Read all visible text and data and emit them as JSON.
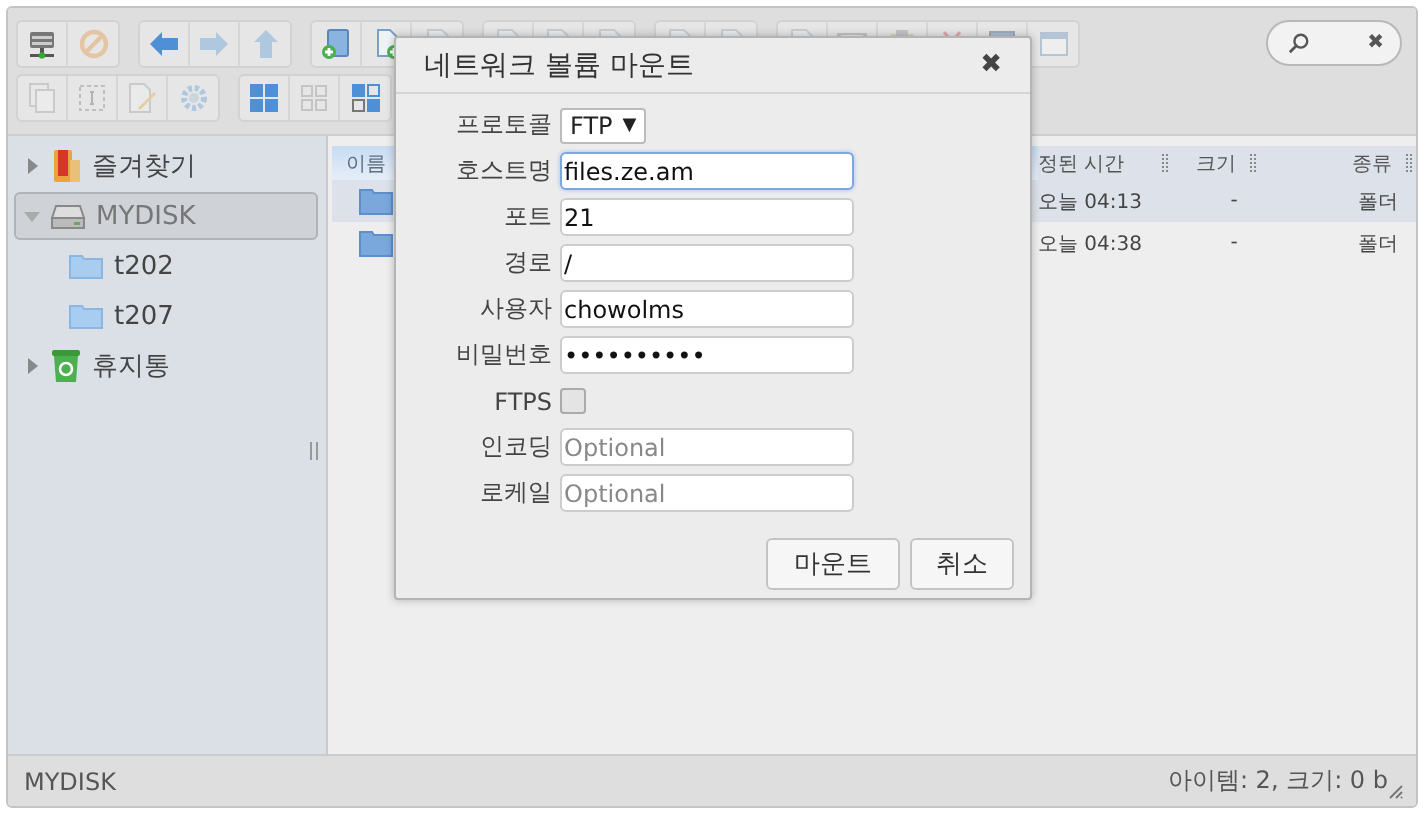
{
  "toolbar": {
    "rows": [
      {
        "groups": [
          {
            "buttons": [
              {
                "disabled": false
              },
              {
                "disabled": true
              }
            ]
          },
          {
            "buttons": [
              {
                "disabled": false
              },
              {
                "disabled": true
              },
              {
                "disabled": true
              }
            ]
          },
          {
            "buttons": [
              {
                "disabled": false
              },
              {
                "disabled": false
              },
              {
                "disabled": true
              }
            ]
          },
          {
            "buttons": [
              {
                "disabled": true
              },
              {
                "disabled": true
              },
              {
                "disabled": true
              }
            ]
          },
          {
            "buttons": [
              {
                "disabled": true
              },
              {
                "disabled": true
              }
            ]
          },
          {
            "buttons": [
              {
                "disabled": true
              },
              {
                "disabled": true
              },
              {
                "disabled": true
              },
              {
                "disabled": true
              },
              {
                "disabled": true
              },
              {
                "disabled": true
              }
            ]
          }
        ]
      },
      {
        "groups": [
          {
            "buttons": [
              {
                "disabled": true
              },
              {
                "disabled": true
              },
              {
                "disabled": true
              },
              {
                "disabled": true
              }
            ]
          },
          {
            "buttons": [
              {
                "disabled": false
              },
              {
                "disabled": true
              },
              {
                "disabled": false
              }
            ]
          }
        ]
      }
    ]
  },
  "search": {
    "clear": "✖"
  },
  "sidebar": {
    "items": [
      {
        "label": "즐겨찾기",
        "expanded": false,
        "selected": false
      },
      {
        "label": "MYDISK",
        "expanded": true,
        "selected": true,
        "children": [
          {
            "label": "t202",
            "selected": false
          },
          {
            "label": "t207",
            "selected": false
          }
        ]
      },
      {
        "label": "휴지통",
        "expanded": false,
        "selected": false
      }
    ]
  },
  "file_list": {
    "columns": [
      {
        "label": "이름"
      },
      {
        "label": "정된 시간"
      },
      {
        "label": "크기"
      },
      {
        "label": "종류"
      }
    ],
    "rows": [
      {
        "selected": true,
        "modified": "오늘 04:13",
        "size": "-",
        "kind": "폴더"
      },
      {
        "selected": false,
        "modified": "오늘 04:38",
        "size": "-",
        "kind": "폴더"
      }
    ]
  },
  "dialog": {
    "title": "네트워크 볼륨 마운트",
    "close": "✖",
    "fields": [
      {
        "kind": "select",
        "label": "프로토콜",
        "value": "FTP",
        "caret": "▼"
      },
      {
        "kind": "text",
        "label": "호스트명",
        "value": "files.ze.am",
        "focused": true
      },
      {
        "kind": "text",
        "label": "포트",
        "value": "21",
        "focused": false
      },
      {
        "kind": "text",
        "label": "경로",
        "value": "/",
        "focused": false
      },
      {
        "kind": "text",
        "label": "사용자",
        "value": "chowolms",
        "focused": false
      },
      {
        "kind": "text",
        "label": "비밀번호",
        "value": "••••••••••",
        "focused": false
      },
      {
        "kind": "checkbox",
        "label": "FTPS",
        "checked": false
      },
      {
        "kind": "text",
        "label": "인코딩",
        "placeholder": "Optional",
        "focused": false
      },
      {
        "kind": "text",
        "label": "로케일",
        "placeholder": "Optional",
        "focused": false
      }
    ],
    "buttons": [
      {
        "label": "마운트"
      },
      {
        "label": "취소"
      }
    ]
  },
  "status_bar": {
    "left": "MYDISK",
    "right": "아이템: 2, 크기: 0 b"
  }
}
